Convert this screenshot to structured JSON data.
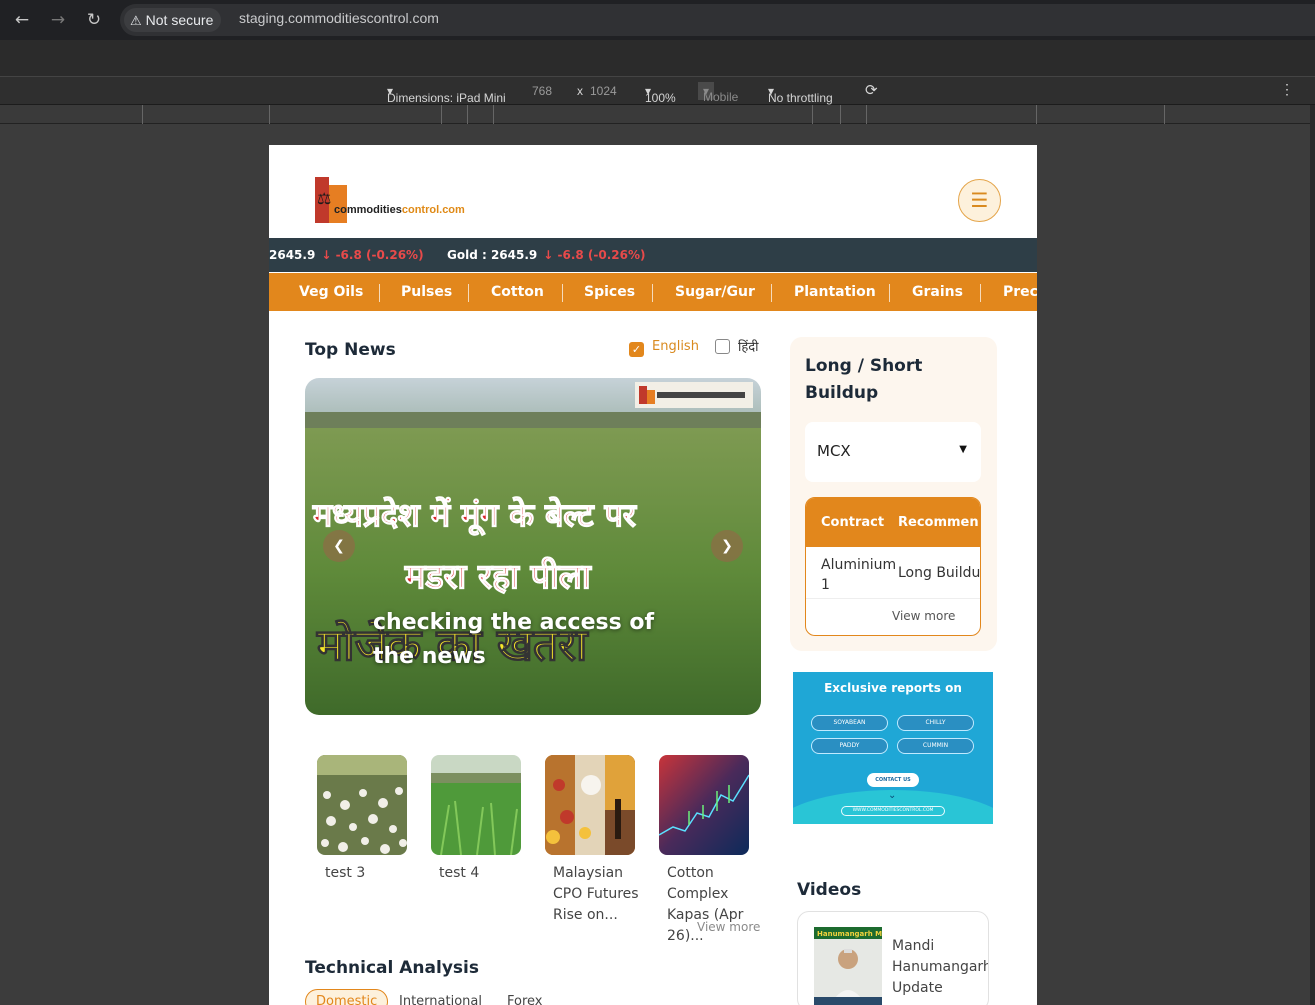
{
  "browser": {
    "security_label": "Not secure",
    "url": "staging.commoditiescontrol.com"
  },
  "devtools": {
    "dimensions_label": "Dimensions: iPad Mini",
    "width": "768",
    "times": "x",
    "height": "1024",
    "zoom": "100%",
    "mode": "Mobile",
    "throttling": "No throttling"
  },
  "site": {
    "logo_dark": "commodities",
    "logo_orange": "control.com"
  },
  "ticker": [
    {
      "label": "2645.9",
      "change": "-6.8 (-0.26%)"
    },
    {
      "label": "Gold : 2645.9",
      "change": "-6.8 (-0.26%)"
    }
  ],
  "categories": [
    "Veg Oils",
    "Pulses",
    "Cotton",
    "Spices",
    "Sugar/Gur",
    "Plantation",
    "Grains",
    "Preci"
  ],
  "top_news": {
    "title": "Top News",
    "lang_english": "English",
    "lang_hindi": "हिंदी",
    "hero_caption": "checking the access of the news",
    "hero_overlay_line1": "मध्यप्रदेश में मूंग के बेल्ट पर",
    "hero_overlay_line2": "मडरा रहा पीला",
    "hero_overlay_line3": "मोजेक का खतरा",
    "thumbs": [
      {
        "title": "test 3"
      },
      {
        "title": "test 4"
      },
      {
        "title": "Malaysian CPO Futures Rise on..."
      },
      {
        "title": "Cotton Complex Kapas (Apr 26)..."
      }
    ],
    "view_more": "View more"
  },
  "technical_analysis": {
    "title": "Technical Analysis",
    "tabs": [
      "Domestic",
      "International",
      "Forex"
    ]
  },
  "buildup": {
    "title": "Long / Short Buildup",
    "exchange": "MCX",
    "col_contract": "Contract",
    "col_recommendation": "Recommen",
    "row_contract": "Aluminium 1",
    "row_recommendation": "Long Buildu",
    "view_more": "View more"
  },
  "banner": {
    "title": "Exclusive reports on",
    "pills": [
      "SOYABEAN",
      "CHILLY",
      "PADDY",
      "CUMMIN"
    ],
    "contact": "CONTACT US",
    "url": "WWW.COMMODITIESCONTROL.COM"
  },
  "videos": {
    "title": "Videos",
    "item_title_line1": "Mandi",
    "item_title_line2": "Hanumangarh",
    "item_title_line3": "Update",
    "thumb_caption": "Hanumangarh Mandi Up"
  }
}
